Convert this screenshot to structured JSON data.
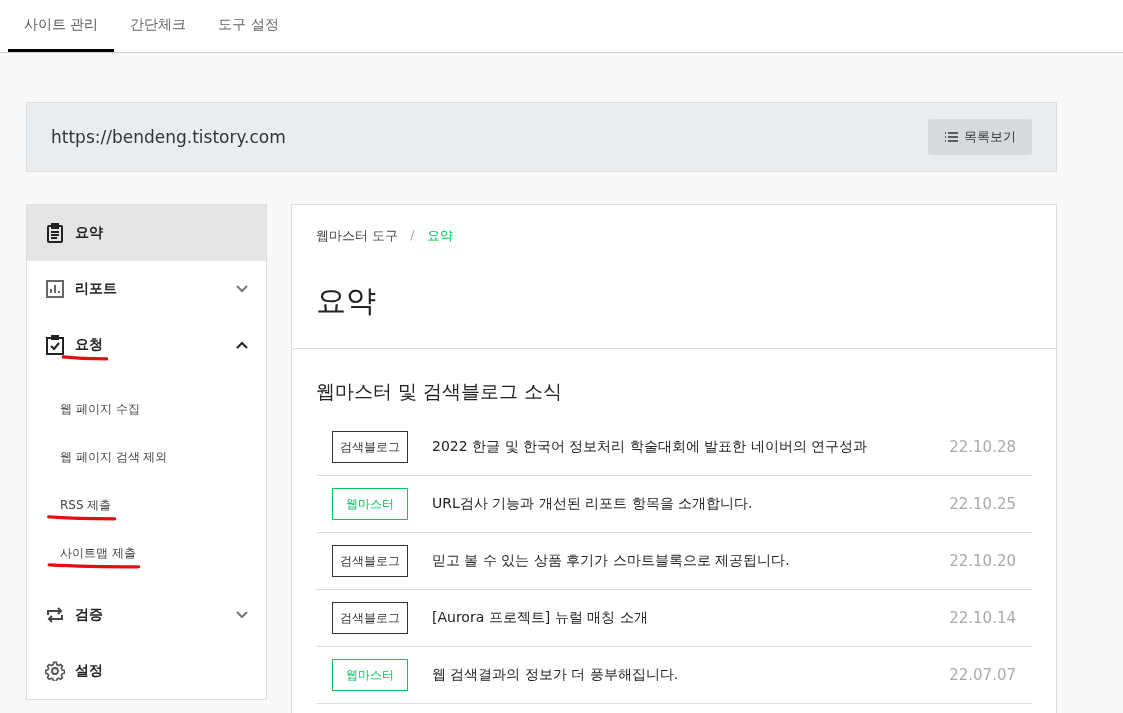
{
  "tabs": [
    {
      "label": "사이트 관리",
      "selected": true
    },
    {
      "label": "간단체크",
      "selected": false
    },
    {
      "label": "도구 설정",
      "selected": false
    }
  ],
  "site": {
    "url": "https://bendeng.tistory.com",
    "list_button": "목록보기"
  },
  "sidebar": {
    "items": [
      {
        "label": "요약",
        "kind": "summary",
        "selected": true,
        "underlined": false
      },
      {
        "label": "리포트",
        "kind": "report",
        "selected": false,
        "expanded": false,
        "underlined": false
      },
      {
        "label": "요청",
        "kind": "request",
        "selected": false,
        "expanded": true,
        "underlined": true,
        "children": [
          {
            "label": "웹 페이지 수집",
            "underlined": false
          },
          {
            "label": "웹 페이지 검색 제외",
            "underlined": false
          },
          {
            "label": "RSS 제출",
            "underlined": true
          },
          {
            "label": "사이트맵 제출",
            "underlined": true
          }
        ]
      },
      {
        "label": "검증",
        "kind": "verify",
        "selected": false,
        "expanded": false,
        "underlined": false
      },
      {
        "label": "설정",
        "kind": "settings",
        "selected": false,
        "underlined": false
      }
    ]
  },
  "main": {
    "breadcrumb_separator": "/",
    "breadcrumb": [
      {
        "label": "웹마스터 도구",
        "selected": false
      },
      {
        "label": "요약",
        "selected": true
      }
    ],
    "title": "요약",
    "section_title": "웹마스터 및 검색블로그 소식",
    "news": [
      {
        "tag": "검색블로그",
        "kind": "blog",
        "title": "2022 한글 및 한국어 정보처리 학술대회에 발표한 네이버의 연구성과",
        "date": "22.10.28"
      },
      {
        "tag": "웹마스터",
        "kind": "webmaster",
        "title": "URL검사 기능과 개선된 리포트 항목을 소개합니다.",
        "date": "22.10.25"
      },
      {
        "tag": "검색블로그",
        "kind": "blog",
        "title": "믿고 볼 수 있는 상품 후기가 스마트블록으로 제공됩니다.",
        "date": "22.10.20"
      },
      {
        "tag": "검색블로그",
        "kind": "blog",
        "title": "[Aurora 프로젝트] 뉴럴 매칭 소개",
        "date": "22.10.14"
      },
      {
        "tag": "웹마스터",
        "kind": "webmaster",
        "title": "웹 검색결과의 정보가 더 풍부해집니다.",
        "date": "22.07.07"
      }
    ]
  }
}
